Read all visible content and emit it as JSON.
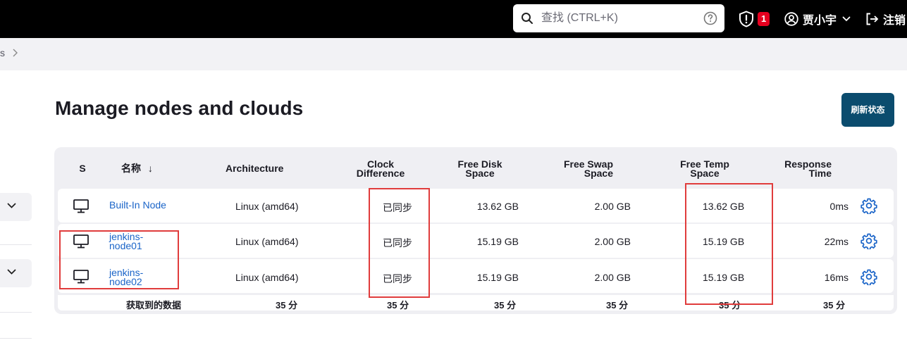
{
  "topbar": {
    "search": {
      "placeholder": "查找 (CTRL+K)",
      "value": ""
    },
    "security_badge": "1",
    "user_name": "贾小宇",
    "logout_label": "注销"
  },
  "breadcrumb": {
    "fragment": "s"
  },
  "page": {
    "title": "Manage nodes and clouds",
    "refresh_label": "刷新状态"
  },
  "table": {
    "headers": {
      "status": "S",
      "name": "名称",
      "name_sort": "↓",
      "architecture": "Architecture",
      "clock_1": "Clock",
      "clock_2": "Difference",
      "disk_1": "Free Disk",
      "disk_2": "Space",
      "swap_1": "Free Swap",
      "swap_2": "Space",
      "temp_1": "Free Temp",
      "temp_2": "Space",
      "resp_1": "Response",
      "resp_2": "Time"
    },
    "rows": [
      {
        "name_1": "Built-In Node",
        "name_2": "",
        "arch": "Linux (amd64)",
        "clock": "已同步",
        "disk": "13.62 GB",
        "swap": "2.00 GB",
        "temp": "13.62 GB",
        "resp": "0ms"
      },
      {
        "name_1": "jenkins-",
        "name_2": "node01",
        "arch": "Linux (amd64)",
        "clock": "已同步",
        "disk": "15.19 GB",
        "swap": "2.00 GB",
        "temp": "15.19 GB",
        "resp": "22ms"
      },
      {
        "name_1": "jenkins-",
        "name_2": "node02",
        "arch": "Linux (amd64)",
        "clock": "已同步",
        "disk": "15.19 GB",
        "swap": "2.00 GB",
        "temp": "15.19 GB",
        "resp": "16ms"
      }
    ],
    "footer": {
      "label": "获取到的数据",
      "arch": "35 分",
      "clock": "35 分",
      "disk": "35 分",
      "swap": "35 分",
      "temp": "35 分",
      "resp": "35 分"
    }
  },
  "colors": {
    "topbar": "#000000",
    "link": "#1a64c8",
    "primary_button": "#0b4c6e",
    "badge": "#e6001f",
    "highlight": "#e03c3c"
  }
}
